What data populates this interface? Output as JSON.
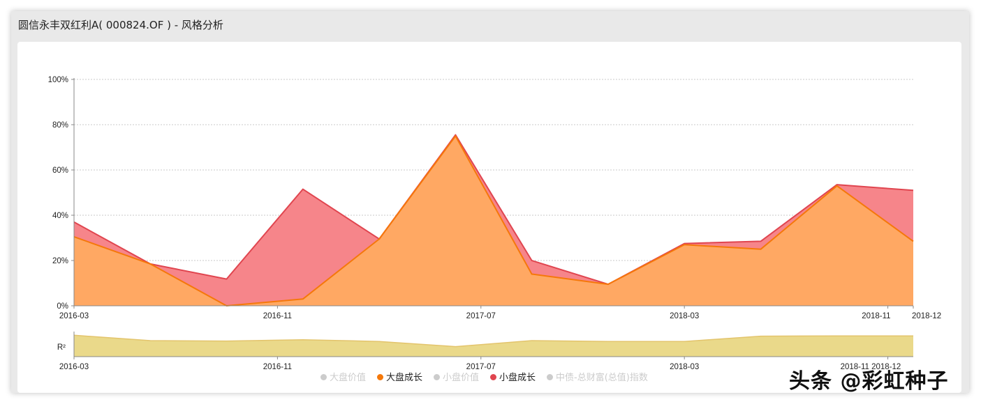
{
  "header": {
    "title": "圆信永丰双红利A( 000824.OF ) - 风格分析"
  },
  "watermark": "头条 @彩虹种子",
  "colors": {
    "small_growth": "#e0454f",
    "small_growth_fill": "#f6858a",
    "large_growth": "#f5780a",
    "large_growth_fill": "#ffa863",
    "r2_fill": "#ead98a",
    "r2_line": "#e3c46c",
    "grid": "#c9c9c9",
    "axis": "#888888",
    "legend_inactive": "#cccccc"
  },
  "legend": [
    {
      "name": "大盘价值",
      "active": false,
      "color": "#cccccc"
    },
    {
      "name": "大盘成长",
      "active": true,
      "color": "#f5780a"
    },
    {
      "name": "小盘价值",
      "active": false,
      "color": "#cccccc"
    },
    {
      "name": "小盘成长",
      "active": true,
      "color": "#e0454f"
    },
    {
      "name": "中债-总财富(总值)指数",
      "active": false,
      "color": "#cccccc"
    }
  ],
  "chart_data": [
    {
      "type": "area",
      "stacked": true,
      "x_dates": [
        "2016-03",
        "2016-06",
        "2016-09",
        "2016-12",
        "2017-03",
        "2017-06",
        "2017-09",
        "2017-12",
        "2018-03",
        "2018-06",
        "2018-09",
        "2018-12"
      ],
      "x_tick_labels": [
        "2016-03",
        "2016-11",
        "2017-07",
        "2018-03",
        "2018-11",
        "2018-12"
      ],
      "y_tick_labels": [
        "0%",
        "20%",
        "40%",
        "60%",
        "80%",
        "100%"
      ],
      "ylim": [
        0,
        100
      ],
      "grid": true,
      "series": [
        {
          "name": "大盘成长",
          "values": [
            30.5,
            18.5,
            0,
            3,
            29.5,
            75,
            14,
            9.5,
            27,
            25,
            53,
            28.5
          ]
        },
        {
          "name": "小盘成长",
          "values": [
            6.5,
            0,
            11.8,
            48.5,
            0,
            0.5,
            6,
            0,
            0.5,
            3.5,
            0.5,
            22.5
          ]
        }
      ]
    },
    {
      "type": "area",
      "ylabel": "R²",
      "x_dates": [
        "2016-03",
        "2016-06",
        "2016-09",
        "2016-12",
        "2017-03",
        "2017-06",
        "2017-09",
        "2017-12",
        "2018-03",
        "2018-06",
        "2018-09",
        "2018-12"
      ],
      "x_tick_labels": [
        "2016-03",
        "2016-11",
        "2017-07",
        "2018-03",
        "2018-11 2018-12"
      ],
      "ylim": [
        0,
        1
      ],
      "series": [
        {
          "values": [
            0.96,
            0.72,
            0.7,
            0.76,
            0.68,
            0.45,
            0.72,
            0.68,
            0.68,
            0.92,
            0.93,
            0.93
          ]
        }
      ]
    }
  ]
}
